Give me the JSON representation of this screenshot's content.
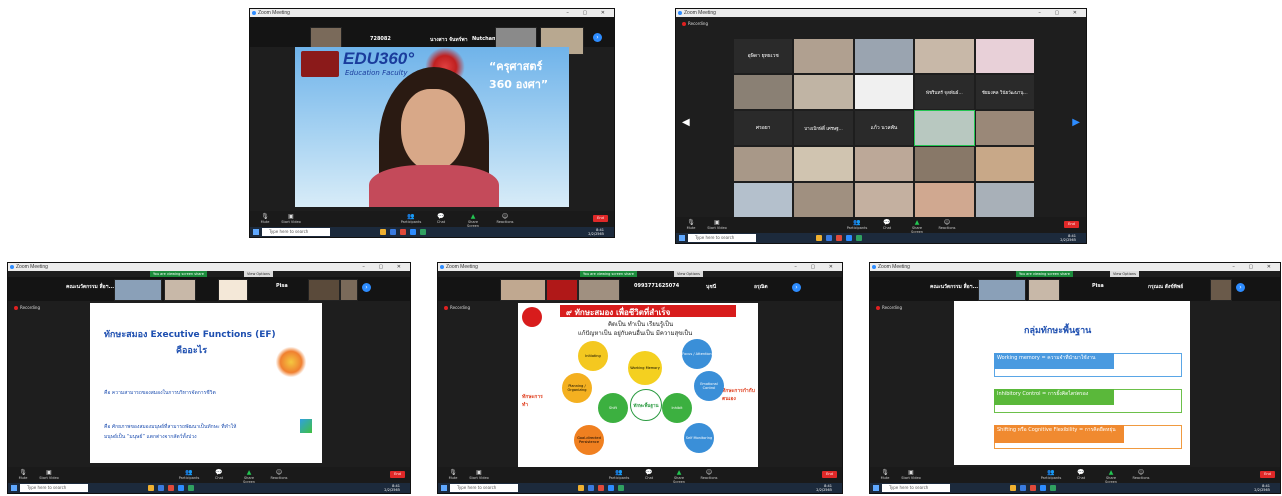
{
  "common": {
    "window_title": "Zoom Meeting",
    "search_placeholder": "Type here to search",
    "recording": "Recording",
    "view_options": "View Options",
    "sharing_banner": "You are viewing screen share",
    "end": "End",
    "controls": [
      "Mute",
      "Start Video",
      "Participants",
      "Chat",
      "Share Screen",
      "Reactions"
    ],
    "clock_time": "8:41",
    "clock_date": "2/2/2565"
  },
  "shot1": {
    "tile_names": [
      "728082",
      "นางสาว จันทร์พา",
      "Nutchana"
    ],
    "edu_logo": "EDU360°",
    "edu_sub": "Education Faculty",
    "program_title": "“ครุศาสตร์ 360 องศา”"
  },
  "shot2": {
    "tile_names": [
      "อุษิดา ยุทธเวช",
      "พัชรินทร์ จุลพันธ์...",
      "ชัยมงคล วินัยวัฒนานุ...",
      "ศรอยา",
      "บางเบิกษัติ์ เศรษฐ...",
      "แก้ว นวลพัน"
    ]
  },
  "shot3": {
    "tile_names": [
      "คณะนวัตกรรม สื่อฯ...",
      "Pisa"
    ],
    "slide_title": "ทักษะสมอง Executive Functions (EF)",
    "slide_subtitle": "คืออะไร",
    "line1": "คือ ความสามารถของสมองในการบริหารจัดการชีวิต",
    "line2": "คือ ศักยภาพของสมองมนุษย์ที่สามารถพัฒนาเป็นทักษะ ที่ทำให้",
    "line3": "มนุษย์เป็น “มนุษย์” แตกต่างจากสัตว์ทั้งปวง"
  },
  "shot4": {
    "tile_names": [
      "0993771625074",
      "นุชนี",
      "อรุณิต"
    ],
    "heading": "๙ ทักษะสมอง เพื่อชีวิตที่สำเร็จ",
    "sub1": "คิดเป็น ทำเป็น เรียนรู้เป็น",
    "sub2": "แก้ปัญหาเป็น อยู่กับคนอื่นเป็น มีความสุขเป็น",
    "nodes": [
      "Working Memory",
      "Inhibit",
      "Shift",
      "Emotional Control",
      "Planning / Organizing",
      "Initiating",
      "Focus / Attention",
      "Self Monitoring",
      "Goal-directed Persistence"
    ],
    "center": "ทักษะพื้นฐาน",
    "left_label": "ทักษะการทำ",
    "right_label": "ทักษะการกำกับตนเอง"
  },
  "shot5": {
    "tile_names": [
      "คณะนวัตกรรม สื่อฯ...",
      "Pisa",
      "กรุณณ สังข์ทิพย์"
    ],
    "title": "กลุ่มทักษะพื้นฐาน",
    "box1": "Working memory = ความจำที่นำมาใช้งาน",
    "box2": "Inhibitory Control = การยั้งคิดไตร่ตรอง",
    "box3": "Shifting หรือ Cognitive Flexibility = การคิดยืดหยุ่น"
  },
  "colors": {
    "zoom_blue": "#2d8cff",
    "end_red": "#e02828",
    "share_green": "#23c552",
    "edu_blue": "#1a3c9c"
  }
}
